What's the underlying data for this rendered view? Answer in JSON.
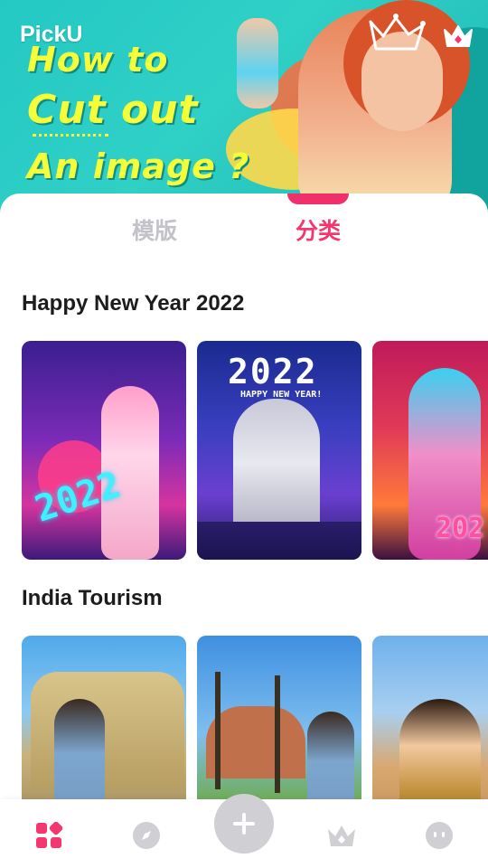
{
  "app": {
    "name": "PickU"
  },
  "banner": {
    "headline_line1": "How to",
    "headline_line2": "Cut out",
    "headline_line3": "An image ?"
  },
  "tabs": [
    {
      "label": "模版",
      "active": false
    },
    {
      "label": "分类",
      "active": true
    }
  ],
  "sections": [
    {
      "title": "Happy New Year 2022",
      "cards": [
        {
          "overlay_text": "2022"
        },
        {
          "overlay_text": "2022",
          "sub_text": "HAPPY NEW YEAR!"
        },
        {
          "overlay_text": "202"
        }
      ]
    },
    {
      "title": "India Tourism",
      "cards": [
        {},
        {},
        {}
      ]
    }
  ],
  "bottom_nav": {
    "items": [
      "home-icon",
      "compass-icon",
      "add-icon",
      "crown-icon",
      "profile-face-icon"
    ]
  },
  "colors": {
    "accent": "#f2386e",
    "banner_bg": "#24c9c4",
    "inactive": "#c2c2c8"
  }
}
